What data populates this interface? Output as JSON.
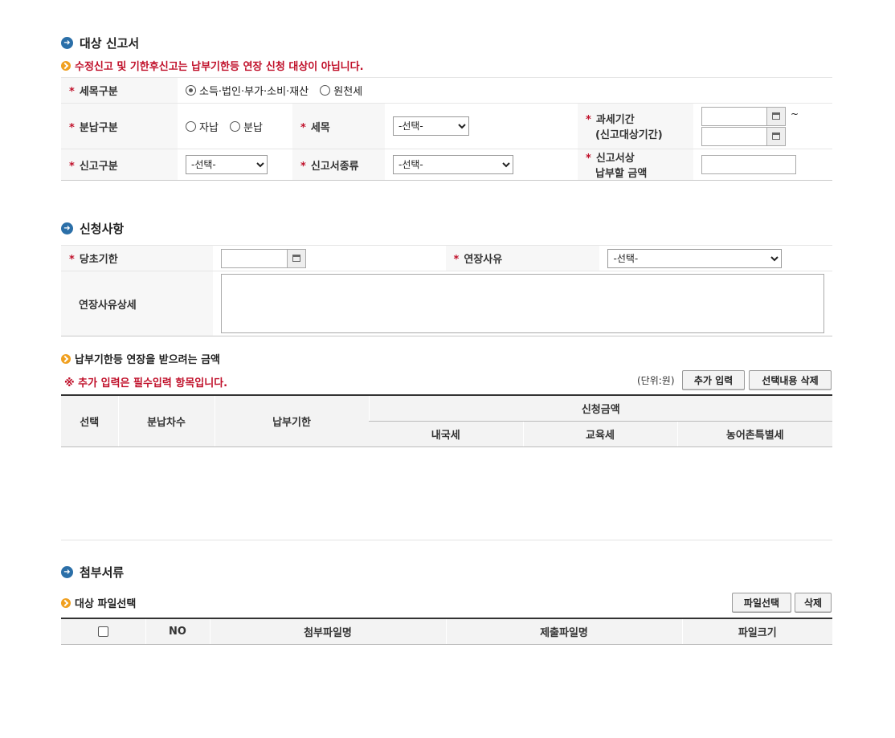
{
  "target_section": {
    "title": "대상 신고서",
    "notice": "수정신고 및 기한후신고는 납부기한등 연장 신청 대상이 아닙니다.",
    "tax_item_type": {
      "label": "세목구분",
      "options": [
        "소득·법인·부가·소비·재산",
        "원천세"
      ],
      "selected": "소득·법인·부가·소비·재산"
    },
    "installment_type": {
      "label": "분납구분",
      "options": [
        "자납",
        "분납"
      ]
    },
    "tax_item": {
      "label": "세목",
      "value": "-선택-"
    },
    "tax_period": {
      "label_line1": "과세기간",
      "label_line2": "(신고대상기간)",
      "separator": "~"
    },
    "report_type": {
      "label": "신고구분",
      "value": "-선택-"
    },
    "report_form_type": {
      "label": "신고서종류",
      "value": "-선택-"
    },
    "payable_amount": {
      "label_line1": "신고서상",
      "label_line2": "납부할 금액"
    }
  },
  "request_section": {
    "title": "신청사항",
    "original_deadline": {
      "label": "당초기한"
    },
    "extension_reason": {
      "label": "연장사유",
      "value": "-선택-"
    },
    "reason_detail": {
      "label": "연장사유상세"
    }
  },
  "amount_section": {
    "title": "납부기한등 연장을 받으려는 금액",
    "required_note": "※ 추가 입력은 필수입력 항목입니다.",
    "unit": "(단위:원)",
    "add_button": "추가 입력",
    "delete_selected_button": "선택내용 삭제",
    "columns": {
      "select": "선택",
      "installment_no": "분납차수",
      "deadline": "납부기한",
      "request_amount": "신청금액",
      "national_tax": "내국세",
      "education_tax": "교육세",
      "rural_tax": "농어촌특별세"
    }
  },
  "attachment_section": {
    "title": "첨부서류",
    "subtitle": "대상 파일선택",
    "select_file_button": "파일선택",
    "delete_button": "삭제",
    "columns": {
      "no": "NO",
      "attached_name": "첨부파일명",
      "submitted_name": "제출파일명",
      "size": "파일크기"
    }
  }
}
